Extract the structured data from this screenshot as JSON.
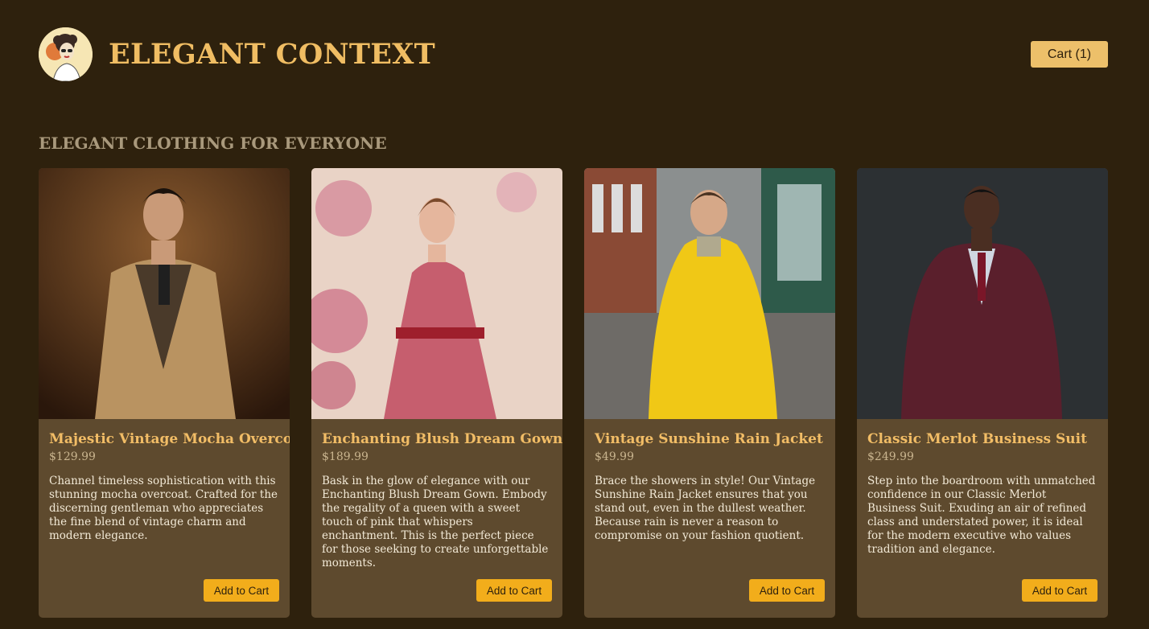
{
  "header": {
    "brand": "ELEGANT CONTEXT",
    "cart_label": "Cart (1)"
  },
  "section": {
    "title": "ELEGANT CLOTHING FOR EVERYONE"
  },
  "products": [
    {
      "name": "Majestic Vintage Mocha Overcoat",
      "price": "$129.99",
      "description": "Channel timeless sophistication with this stunning mocha overcoat. Crafted for the discerning gentleman who appreciates the fine blend of vintage charm and modern elegance.",
      "button": "Add to Cart"
    },
    {
      "name": "Enchanting Blush Dream Gown",
      "price": "$189.99",
      "description": "Bask in the glow of elegance with our Enchanting Blush Dream Gown. Embody the regality of a queen with a sweet touch of pink that whispers enchantment. This is the perfect piece for those seeking to create unforgettable moments.",
      "button": "Add to Cart"
    },
    {
      "name": "Vintage Sunshine Rain Jacket",
      "price": "$49.99",
      "description": "Brace the showers in style! Our Vintage Sunshine Rain Jacket ensures that you stand out, even in the dullest weather. Because rain is never a reason to compromise on your fashion quotient.",
      "button": "Add to Cart"
    },
    {
      "name": "Classic Merlot Business Suit",
      "price": "$249.99",
      "description": "Step into the boardroom with unmatched confidence in our Classic Merlot Business Suit. Exuding an air of refined class and understated power, it is ideal for the modern executive who values tradition and elegance.",
      "button": "Add to Cart"
    }
  ]
}
